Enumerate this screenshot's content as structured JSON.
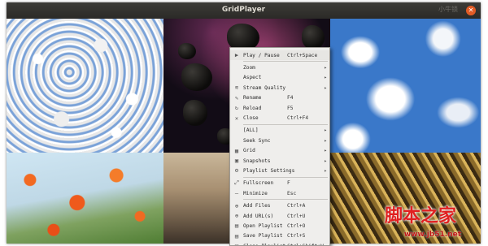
{
  "window": {
    "title": "GridPlayer",
    "close_glyph": "✕",
    "logo_text": "小牛锁"
  },
  "watermark": {
    "text": "脚本之家",
    "url": "www.jb51.net"
  },
  "menu": {
    "groups": [
      [
        {
          "icon": "play-icon",
          "glyph": "▶",
          "label": "Play / Pause",
          "shortcut": "Ctrl+Space",
          "submenu": false
        }
      ],
      [
        {
          "icon": "zoom-icon",
          "glyph": "",
          "label": "Zoom",
          "shortcut": "",
          "submenu": true
        },
        {
          "icon": "aspect-icon",
          "glyph": "",
          "label": "Aspect",
          "shortcut": "",
          "submenu": true
        },
        {
          "icon": "stream-quality-icon",
          "glyph": "≋",
          "label": "Stream Quality",
          "shortcut": "",
          "submenu": true
        },
        {
          "icon": "rename-icon",
          "glyph": "✎",
          "label": "Rename",
          "shortcut": "F4",
          "submenu": false
        },
        {
          "icon": "reload-icon",
          "glyph": "↻",
          "label": "Reload",
          "shortcut": "F5",
          "submenu": false
        },
        {
          "icon": "close-icon",
          "glyph": "✕",
          "label": "Close",
          "shortcut": "Ctrl+F4",
          "submenu": false
        }
      ],
      [
        {
          "icon": "all-icon",
          "glyph": "",
          "label": "[ALL]",
          "shortcut": "",
          "submenu": true
        },
        {
          "icon": "seek-sync-icon",
          "glyph": "",
          "label": "Seek Sync",
          "shortcut": "",
          "submenu": true
        },
        {
          "icon": "grid-icon",
          "glyph": "▦",
          "label": "Grid",
          "shortcut": "",
          "submenu": true
        },
        {
          "icon": "snapshots-icon",
          "glyph": "▣",
          "label": "Snapshots",
          "shortcut": "",
          "submenu": true
        },
        {
          "icon": "playlist-settings-icon",
          "glyph": "⚙",
          "label": "Playlist Settings",
          "shortcut": "",
          "submenu": true
        }
      ],
      [
        {
          "icon": "fullscreen-icon",
          "glyph": "⤢",
          "label": "Fullscreen",
          "shortcut": "F",
          "submenu": false
        },
        {
          "icon": "minimize-icon",
          "glyph": "—",
          "label": "Minimize",
          "shortcut": "Esc",
          "submenu": false
        }
      ],
      [
        {
          "icon": "add-files-icon",
          "glyph": "⊕",
          "label": "Add Files",
          "shortcut": "Ctrl+A",
          "submenu": false
        },
        {
          "icon": "add-url-icon",
          "glyph": "⊕",
          "label": "Add URL(s)",
          "shortcut": "Ctrl+U",
          "submenu": false
        },
        {
          "icon": "open-playlist-icon",
          "glyph": "▤",
          "label": "Open Playlist",
          "shortcut": "Ctrl+O",
          "submenu": false
        },
        {
          "icon": "save-playlist-icon",
          "glyph": "▤",
          "label": "Save Playlist",
          "shortcut": "Ctrl+S",
          "submenu": false
        },
        {
          "icon": "close-playlist-icon",
          "glyph": "▤",
          "label": "Close Playlist",
          "shortcut": "Ctrl+Shift+W",
          "submenu": false
        }
      ]
    ]
  }
}
